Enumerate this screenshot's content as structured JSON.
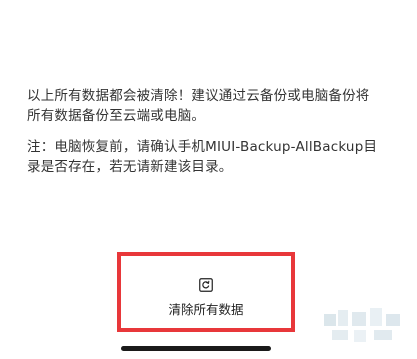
{
  "warning": {
    "line1": "以上所有数据都会被清除！建议通过云备份或电脑备份将",
    "line2": "所有数据备份至云端或电脑。"
  },
  "note": {
    "line1": "注：电脑恢复前，请确认手机MIUI-Backup-AllBackup目",
    "line2": "录是否存在，若无请新建该目录。"
  },
  "action": {
    "label": "清除所有数据",
    "icon": "reset-icon"
  },
  "colors": {
    "highlight": "#e8373a",
    "text": "#333333",
    "home_indicator": "#1a1a1a"
  }
}
